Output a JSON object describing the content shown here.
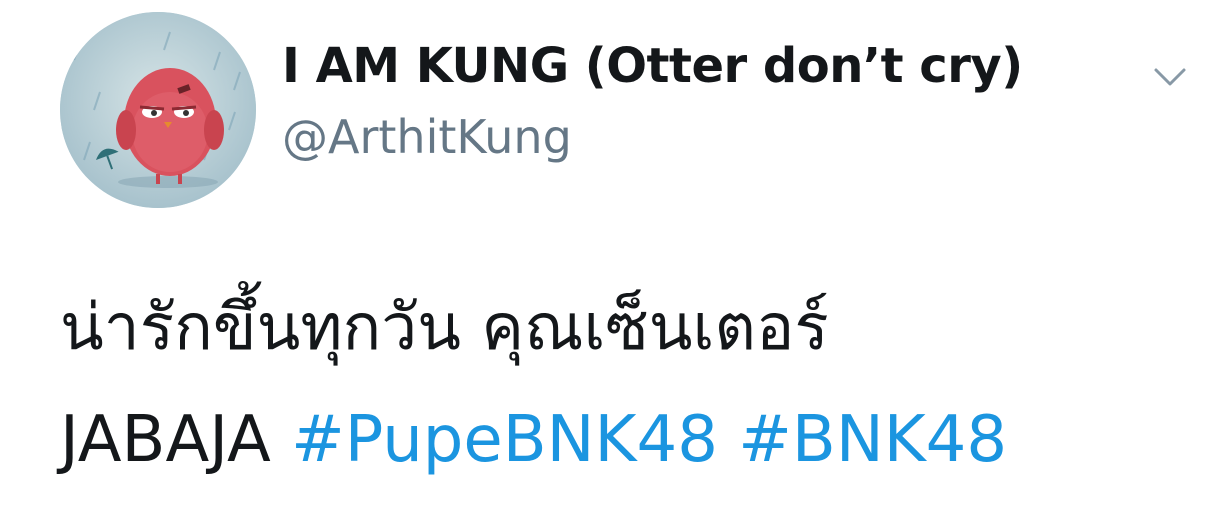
{
  "user": {
    "display_name": "I AM KUNG (Otter don’t cry)",
    "handle": "@ArthitKung",
    "avatar_icon": "red-bird-in-rain-avatar"
  },
  "tweet": {
    "line1": "น่ารักขึ้นทุกวัน คุณเซ็นเตอร์",
    "line2_text": "JABAJA",
    "hashtags": [
      "#PupeBNK48",
      "#BNK48"
    ]
  },
  "menu_icon": "chevron-down-icon",
  "colors": {
    "text": "#14171a",
    "handle": "#657786",
    "link": "#1b95e0",
    "caret": "#8899a6"
  }
}
